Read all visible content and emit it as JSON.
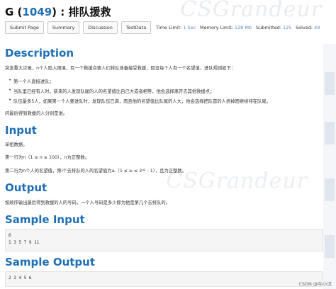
{
  "watermark": "CSGrandeur",
  "problem": {
    "letter": "G",
    "id": "1049",
    "name": "排队援救"
  },
  "buttons": [
    "Submit Page",
    "Summary",
    "Discussion",
    "TestData"
  ],
  "meta": {
    "time_label": "Time Limit:",
    "time_value": "1 Sec",
    "mem_label": "Memory Limit:",
    "mem_value": "128 Mb",
    "sub_label": "Submitted:",
    "sub_value": "125",
    "solved_label": "Solved:",
    "solved_value": "48"
  },
  "description": {
    "heading": "Description",
    "intro": "突发重大灾难，n个人陷入困境，有一个救援点要人们排队准备接受救援，假设每个人有一个名望值，进队规则如下：",
    "rules": [
      "第一个人直接进队；",
      "当队里已经有人时，新来的人发现队尾的人的名望值比自己大或者相等，他会选择离开去其他救援点；",
      "队伍最多5人，如果第一个人要进队时，发现队伍已满，而且他的名望值比队尾的人大，他会选择把队首的人挤掉而继续排在队尾。"
    ],
    "question": "问最后得到救援的人分别是谁。"
  },
  "input": {
    "heading": "Input",
    "line1": "单组数据。",
    "line2": "第一行为n（1 ≤ n ≤ 100），n为正整数。",
    "line3": "第二行为n个人的名望值，第i个去排队的人的名望值为aᵢ（1 ≤ aᵢ ≤ 2³² - 1），且为正整数。"
  },
  "output": {
    "heading": "Output",
    "line1": "按顺序输出最后得到救援的人的号码，一个人号码是多少即为他是第几个去排队的。"
  },
  "sample_input": {
    "heading": "Sample Input",
    "lines": [
      "6",
      "1 3 5 7 9 11"
    ]
  },
  "sample_output": {
    "heading": "Sample Output",
    "lines": [
      "2 3 4 5 6"
    ]
  },
  "footer": "CSDN @牛小汉"
}
